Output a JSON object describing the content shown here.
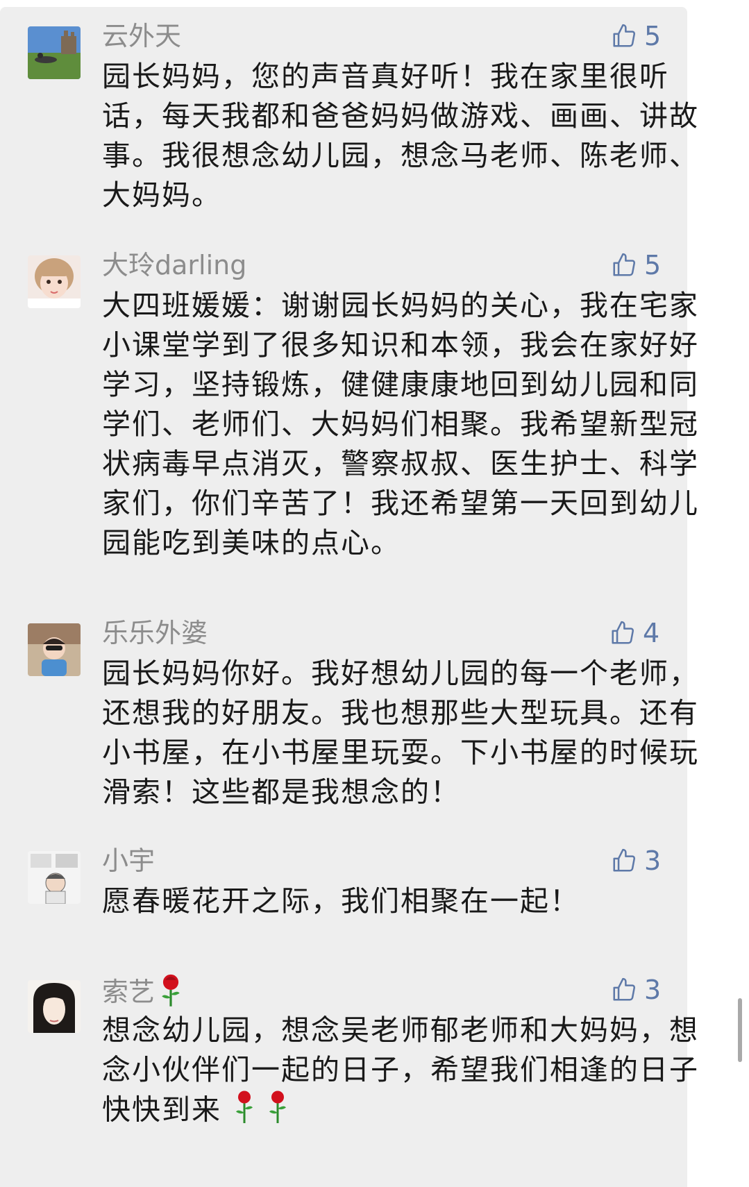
{
  "comments": [
    {
      "author": "云外天",
      "likes": "5",
      "lines": [
        "园长妈妈，您的声音真好听！我在家里很听",
        "话，每天我都和爸爸妈妈做游戏、画画、讲故",
        "事。我很想念幼儿园，想念马老师、陈老师、",
        "大妈妈。"
      ]
    },
    {
      "author": "大玲darling",
      "likes": "5",
      "lines": [
        "大四班媛媛：谢谢园长妈妈的关心，我在宅家",
        "小课堂学到了很多知识和本领，我会在家好好",
        "学习，坚持锻炼，健健康康地回到幼儿园和同",
        "学们、老师们、大妈妈们相聚。我希望新型冠",
        "状病毒早点消灭，警察叔叔、医生护士、科学",
        "家们，你们辛苦了！我还希望第一天回到幼儿",
        "园能吃到美味的点心。"
      ]
    },
    {
      "author": "乐乐外婆",
      "likes": "4",
      "lines": [
        "园长妈妈你好。我好想幼儿园的每一个老师，",
        "还想我的好朋友。我也想那些大型玩具。还有",
        "小书屋，在小书屋里玩耍。下小书屋的时候玩",
        "滑索！这些都是我想念的！"
      ]
    },
    {
      "author": "小宇",
      "likes": "3",
      "lines": [
        "愿春暖花开之际，我们相聚在一起！"
      ]
    },
    {
      "author": "索艺",
      "likes": "3",
      "lines": [
        "想念幼儿园，想念吴老师郁老师和大妈妈，想",
        "念小伙伴们一起的日子，希望我们相逢的日子",
        "快快到来"
      ]
    }
  ],
  "icons": {
    "like": "thumbs-up-icon",
    "rose": "rose-emoji-icon"
  },
  "colors": {
    "background": "#eeeeee",
    "author": "#8c8c8c",
    "like": "#5e79a8",
    "text": "#191919"
  }
}
